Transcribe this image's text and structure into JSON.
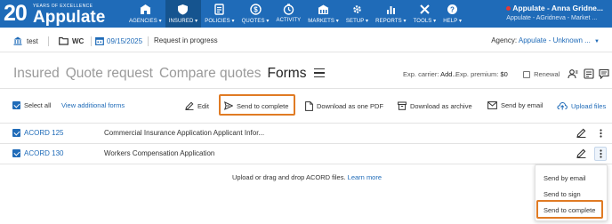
{
  "header": {
    "logo_number": "20",
    "logo_tagline": "YEARS OF EXCELLENCE",
    "logo_brand": "Appulate",
    "nav": [
      {
        "label": "AGENCIES ▾",
        "icon": "agencies-icon"
      },
      {
        "label": "INSURED ▾",
        "icon": "insured-icon",
        "active": true
      },
      {
        "label": "POLICIES ▾",
        "icon": "policies-icon"
      },
      {
        "label": "QUOTES ▾",
        "icon": "quotes-icon"
      },
      {
        "label": "ACTIVITY",
        "icon": "activity-icon"
      },
      {
        "label": "MARKETS ▾",
        "icon": "markets-icon"
      },
      {
        "label": "SETUP ▾",
        "icon": "setup-icon"
      },
      {
        "label": "REPORTS ▾",
        "icon": "reports-icon"
      },
      {
        "label": "TOOLS ▾",
        "icon": "tools-icon"
      },
      {
        "label": "HELP ▾",
        "icon": "help-icon"
      }
    ],
    "user_name": "Appulate - Anna Gridne...",
    "user_sub": "Appulate - AGridneva - Market ..."
  },
  "context": {
    "insured": "test",
    "line": "WC",
    "date": "09/15/2025",
    "status": "Request in progress",
    "agency_label": "Agency:",
    "agency_value": "Appulate - Unknown ..."
  },
  "tabs": {
    "items": [
      "Insured",
      "Quote request",
      "Compare quotes",
      "Forms"
    ],
    "active": "Forms"
  },
  "exp": {
    "carrier_label": "Exp. carrier:",
    "carrier_value": "Add...",
    "premium_label": "Exp. premium:",
    "premium_value": "$0",
    "renewal": "Renewal"
  },
  "toolbar": {
    "select_all": "Select all",
    "view_additional": "View additional forms",
    "edit": "Edit",
    "send_to_complete": "Send to complete",
    "download_pdf": "Download as one PDF",
    "download_archive": "Download as archive",
    "send_by_email": "Send by email",
    "upload_files": "Upload files"
  },
  "forms": [
    {
      "name": "ACORD 125",
      "description": "Commercial Insurance Application Applicant Infor...",
      "checked": true
    },
    {
      "name": "ACORD 130",
      "description": "Workers Compensation Application",
      "checked": true
    }
  ],
  "upload_note": {
    "text": "Upload or drag and drop ACORD files.",
    "link": "Learn more"
  },
  "menu": {
    "items": [
      "Send by email",
      "Send to sign",
      "Send to complete"
    ]
  },
  "colors": {
    "brand_blue": "#1f6bb8",
    "highlight_orange": "#e07b24"
  }
}
